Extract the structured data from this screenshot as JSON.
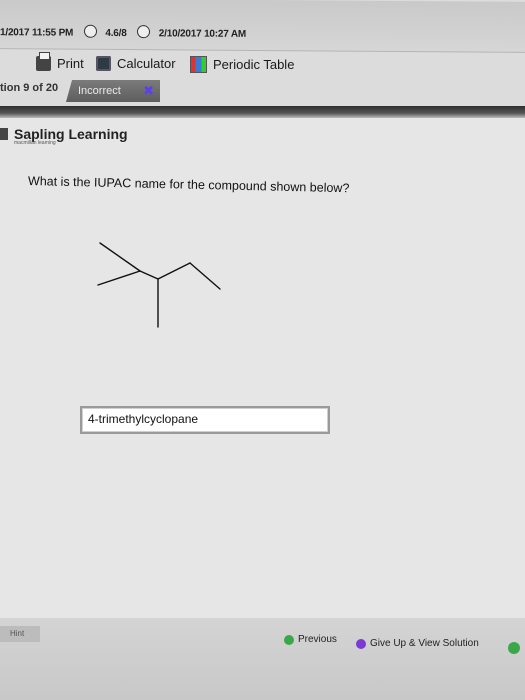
{
  "meta": {
    "date_fragment": "1/2017 11:55 PM",
    "score": "4.6/8",
    "due": "2/10/2017 10:27 AM"
  },
  "toolbar": {
    "print_label": "Print",
    "calculator_label": "Calculator",
    "periodic_table_label": "Periodic Table"
  },
  "status": {
    "question_index": "tion 9 of 20",
    "result": "Incorrect"
  },
  "brand": {
    "name": "Sapling Learning",
    "sub": "macmillan learning"
  },
  "question": {
    "text": "What is the IUPAC name for the compound shown below?"
  },
  "answer": {
    "value": "4-trimethylcyclopane"
  },
  "footer": {
    "hint_label": "Hint",
    "previous_label": "Previous",
    "give_up_label": "Give Up & View Solution"
  },
  "colors": {
    "incorrect_tab": "#6a6a6a",
    "x_mark": "#5d3df0",
    "nav_green": "#3aa84a"
  }
}
